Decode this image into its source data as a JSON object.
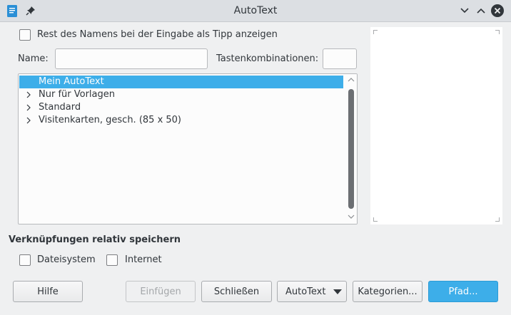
{
  "window": {
    "title": "AutoText"
  },
  "options": {
    "tip_checkbox_label": "Rest des Namens bei der Eingabe als Tipp anzeigen",
    "tip_checked": false
  },
  "fields": {
    "name_label": "Name:",
    "name_value": "",
    "shortcut_label": "Tastenkombinationen:",
    "shortcut_value": ""
  },
  "tree": {
    "items": [
      {
        "label": "Mein AutoText",
        "selected": true,
        "expandable": false
      },
      {
        "label": "Nur für Vorlagen",
        "selected": false,
        "expandable": true
      },
      {
        "label": "Standard",
        "selected": false,
        "expandable": true
      },
      {
        "label": "Visitenkarten, gesch. (85 x 50)",
        "selected": false,
        "expandable": true
      }
    ]
  },
  "relative": {
    "title": "Verknüpfungen relativ speichern",
    "filesystem_label": "Dateisystem",
    "filesystem_checked": false,
    "internet_label": "Internet",
    "internet_checked": false
  },
  "buttons": {
    "help": "Hilfe",
    "insert": "Einfügen",
    "close": "Schließen",
    "autotext": "AutoText",
    "categories": "Kategorien...",
    "path": "Pfad..."
  },
  "colors": {
    "accent": "#3daee9",
    "background": "#eff0f1",
    "titlebar": "#dcdfe3"
  },
  "icons": [
    "document-icon",
    "pin-icon",
    "minimize-icon",
    "maximize-icon",
    "close-icon",
    "chevron-right-icon",
    "scroll-up-icon",
    "scroll-down-icon",
    "dropdown-arrow-icon"
  ]
}
